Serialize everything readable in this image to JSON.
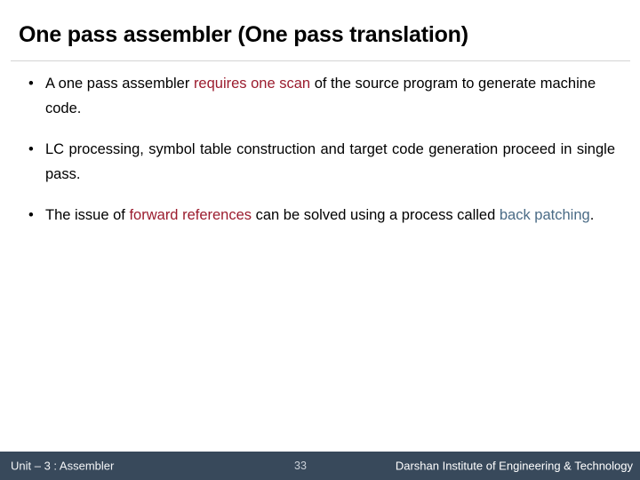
{
  "slide": {
    "title": "One pass assembler (One pass translation)",
    "bullet_marker": "•",
    "bullets": [
      {
        "id": "bullet-1",
        "segments": [
          {
            "text": "A one pass assembler ",
            "color": "black"
          },
          {
            "text": "requires one scan",
            "color": "#9b1c2e"
          },
          {
            "text": " of the source program to generate machine code.",
            "color": "black"
          }
        ],
        "plain_text": "A one pass assembler requires one scan of the source program to generate machine code."
      },
      {
        "id": "bullet-2",
        "segments": [
          {
            "text": "LC processing, symbol table construction and target code generation proceed in single pass.",
            "color": "black"
          }
        ],
        "plain_text": "LC processing, symbol table construction and target code generation proceed in single pass."
      },
      {
        "id": "bullet-3",
        "segments": [
          {
            "text": "The issue of ",
            "color": "black"
          },
          {
            "text": "forward references",
            "color": "#9b1c2e"
          },
          {
            "text": " can be solved using a process called ",
            "color": "black"
          },
          {
            "text": "back patching",
            "color": "#4a6b86"
          },
          {
            "text": ".",
            "color": "black"
          }
        ],
        "plain_text": "The issue of forward references can be solved using a process called back patching."
      }
    ]
  },
  "footer": {
    "unit_label": "Unit – 3 : Assembler",
    "page_number": "33",
    "institute": "Darshan Institute of Engineering & Technology",
    "background_color": "#38495b"
  },
  "theme": {
    "accent_red": "#9b1c2e",
    "accent_steel": "#4a6b86",
    "rule_color": "#d4d4d4",
    "background": "#ffffff",
    "text_color": "#000000"
  }
}
